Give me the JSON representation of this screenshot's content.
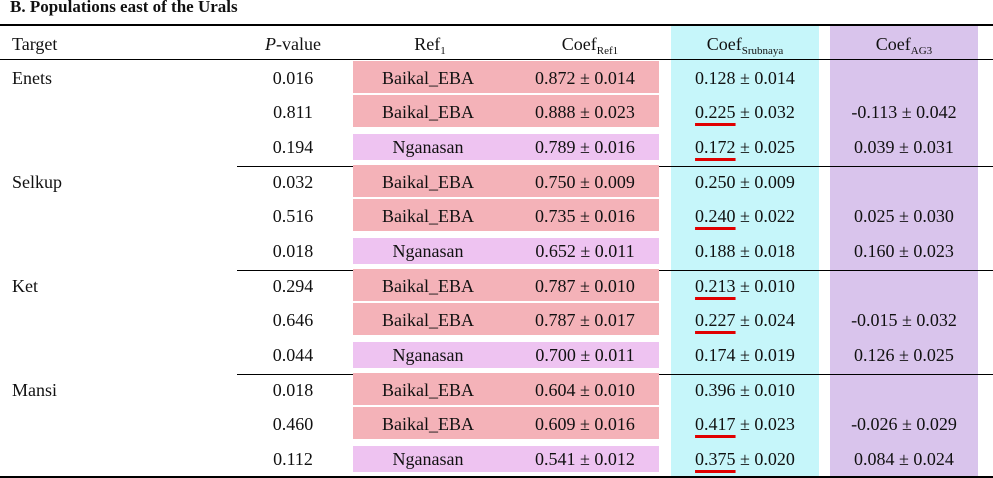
{
  "title": "B. Populations east of the Urals",
  "headers": {
    "target": "Target",
    "pvalue_italic": "P",
    "pvalue_rest": "-value",
    "ref": "Ref",
    "ref_sub": "1",
    "coef_ref": "Coef",
    "coef_ref_sub": "Ref1",
    "coef_srub": "Coef",
    "coef_srub_sub": "Srubnaya",
    "coef_ag3": "Coef",
    "coef_ag3_sub": "AG3"
  },
  "colors": {
    "baikal": "#f4b2b8",
    "nganasan": "#eec3f1",
    "srubnaya_col": "#c6f6fa",
    "ag3_col": "#d9c4ec",
    "underline": "#e00000"
  },
  "groups": [
    {
      "target": "Enets",
      "rows": [
        {
          "p": "0.016",
          "ref": "Baikal_EBA",
          "ref_type": "baikal",
          "coef_ref": "0.872 ± 0.014",
          "srub_val": "0.128",
          "srub_err": " ± 0.014",
          "srub_ul": false,
          "ag3": ""
        },
        {
          "p": "0.811",
          "ref": "Baikal_EBA",
          "ref_type": "baikal",
          "coef_ref": "0.888 ± 0.023",
          "srub_val": "0.225",
          "srub_err": " ± 0.032",
          "srub_ul": true,
          "ag3": "-0.113 ± 0.042"
        },
        {
          "p": "0.194",
          "ref": "Nganasan",
          "ref_type": "nganasan",
          "coef_ref": "0.789 ± 0.016",
          "srub_val": "0.172",
          "srub_err": " ± 0.025",
          "srub_ul": true,
          "ag3": "0.039 ± 0.031"
        }
      ]
    },
    {
      "target": "Selkup",
      "rows": [
        {
          "p": "0.032",
          "ref": "Baikal_EBA",
          "ref_type": "baikal",
          "coef_ref": "0.750 ± 0.009",
          "srub_val": "0.250",
          "srub_err": " ± 0.009",
          "srub_ul": false,
          "ag3": ""
        },
        {
          "p": "0.516",
          "ref": "Baikal_EBA",
          "ref_type": "baikal",
          "coef_ref": "0.735 ± 0.016",
          "srub_val": "0.240",
          "srub_err": " ± 0.022",
          "srub_ul": true,
          "ag3": "0.025 ± 0.030"
        },
        {
          "p": "0.018",
          "ref": "Nganasan",
          "ref_type": "nganasan",
          "coef_ref": "0.652 ± 0.011",
          "srub_val": "0.188",
          "srub_err": " ± 0.018",
          "srub_ul": false,
          "ag3": "0.160 ± 0.023"
        }
      ]
    },
    {
      "target": "Ket",
      "rows": [
        {
          "p": "0.294",
          "ref": "Baikal_EBA",
          "ref_type": "baikal",
          "coef_ref": "0.787 ± 0.010",
          "srub_val": "0.213",
          "srub_err": " ± 0.010",
          "srub_ul": true,
          "ag3": ""
        },
        {
          "p": "0.646",
          "ref": "Baikal_EBA",
          "ref_type": "baikal",
          "coef_ref": "0.787 ± 0.017",
          "srub_val": "0.227",
          "srub_err": " ± 0.024",
          "srub_ul": true,
          "ag3": "-0.015 ± 0.032"
        },
        {
          "p": "0.044",
          "ref": "Nganasan",
          "ref_type": "nganasan",
          "coef_ref": "0.700 ± 0.011",
          "srub_val": "0.174",
          "srub_err": " ± 0.019",
          "srub_ul": false,
          "ag3": "0.126 ± 0.025"
        }
      ]
    },
    {
      "target": "Mansi",
      "rows": [
        {
          "p": "0.018",
          "ref": "Baikal_EBA",
          "ref_type": "baikal",
          "coef_ref": "0.604 ± 0.010",
          "srub_val": "0.396",
          "srub_err": " ± 0.010",
          "srub_ul": false,
          "ag3": ""
        },
        {
          "p": "0.460",
          "ref": "Baikal_EBA",
          "ref_type": "baikal",
          "coef_ref": "0.609 ± 0.016",
          "srub_val": "0.417",
          "srub_err": " ± 0.023",
          "srub_ul": true,
          "ag3": "-0.026 ± 0.029"
        },
        {
          "p": "0.112",
          "ref": "Nganasan",
          "ref_type": "nganasan",
          "coef_ref": "0.541 ± 0.012",
          "srub_val": "0.375",
          "srub_err": " ± 0.020",
          "srub_ul": true,
          "ag3": "0.084 ± 0.024"
        }
      ]
    }
  ]
}
